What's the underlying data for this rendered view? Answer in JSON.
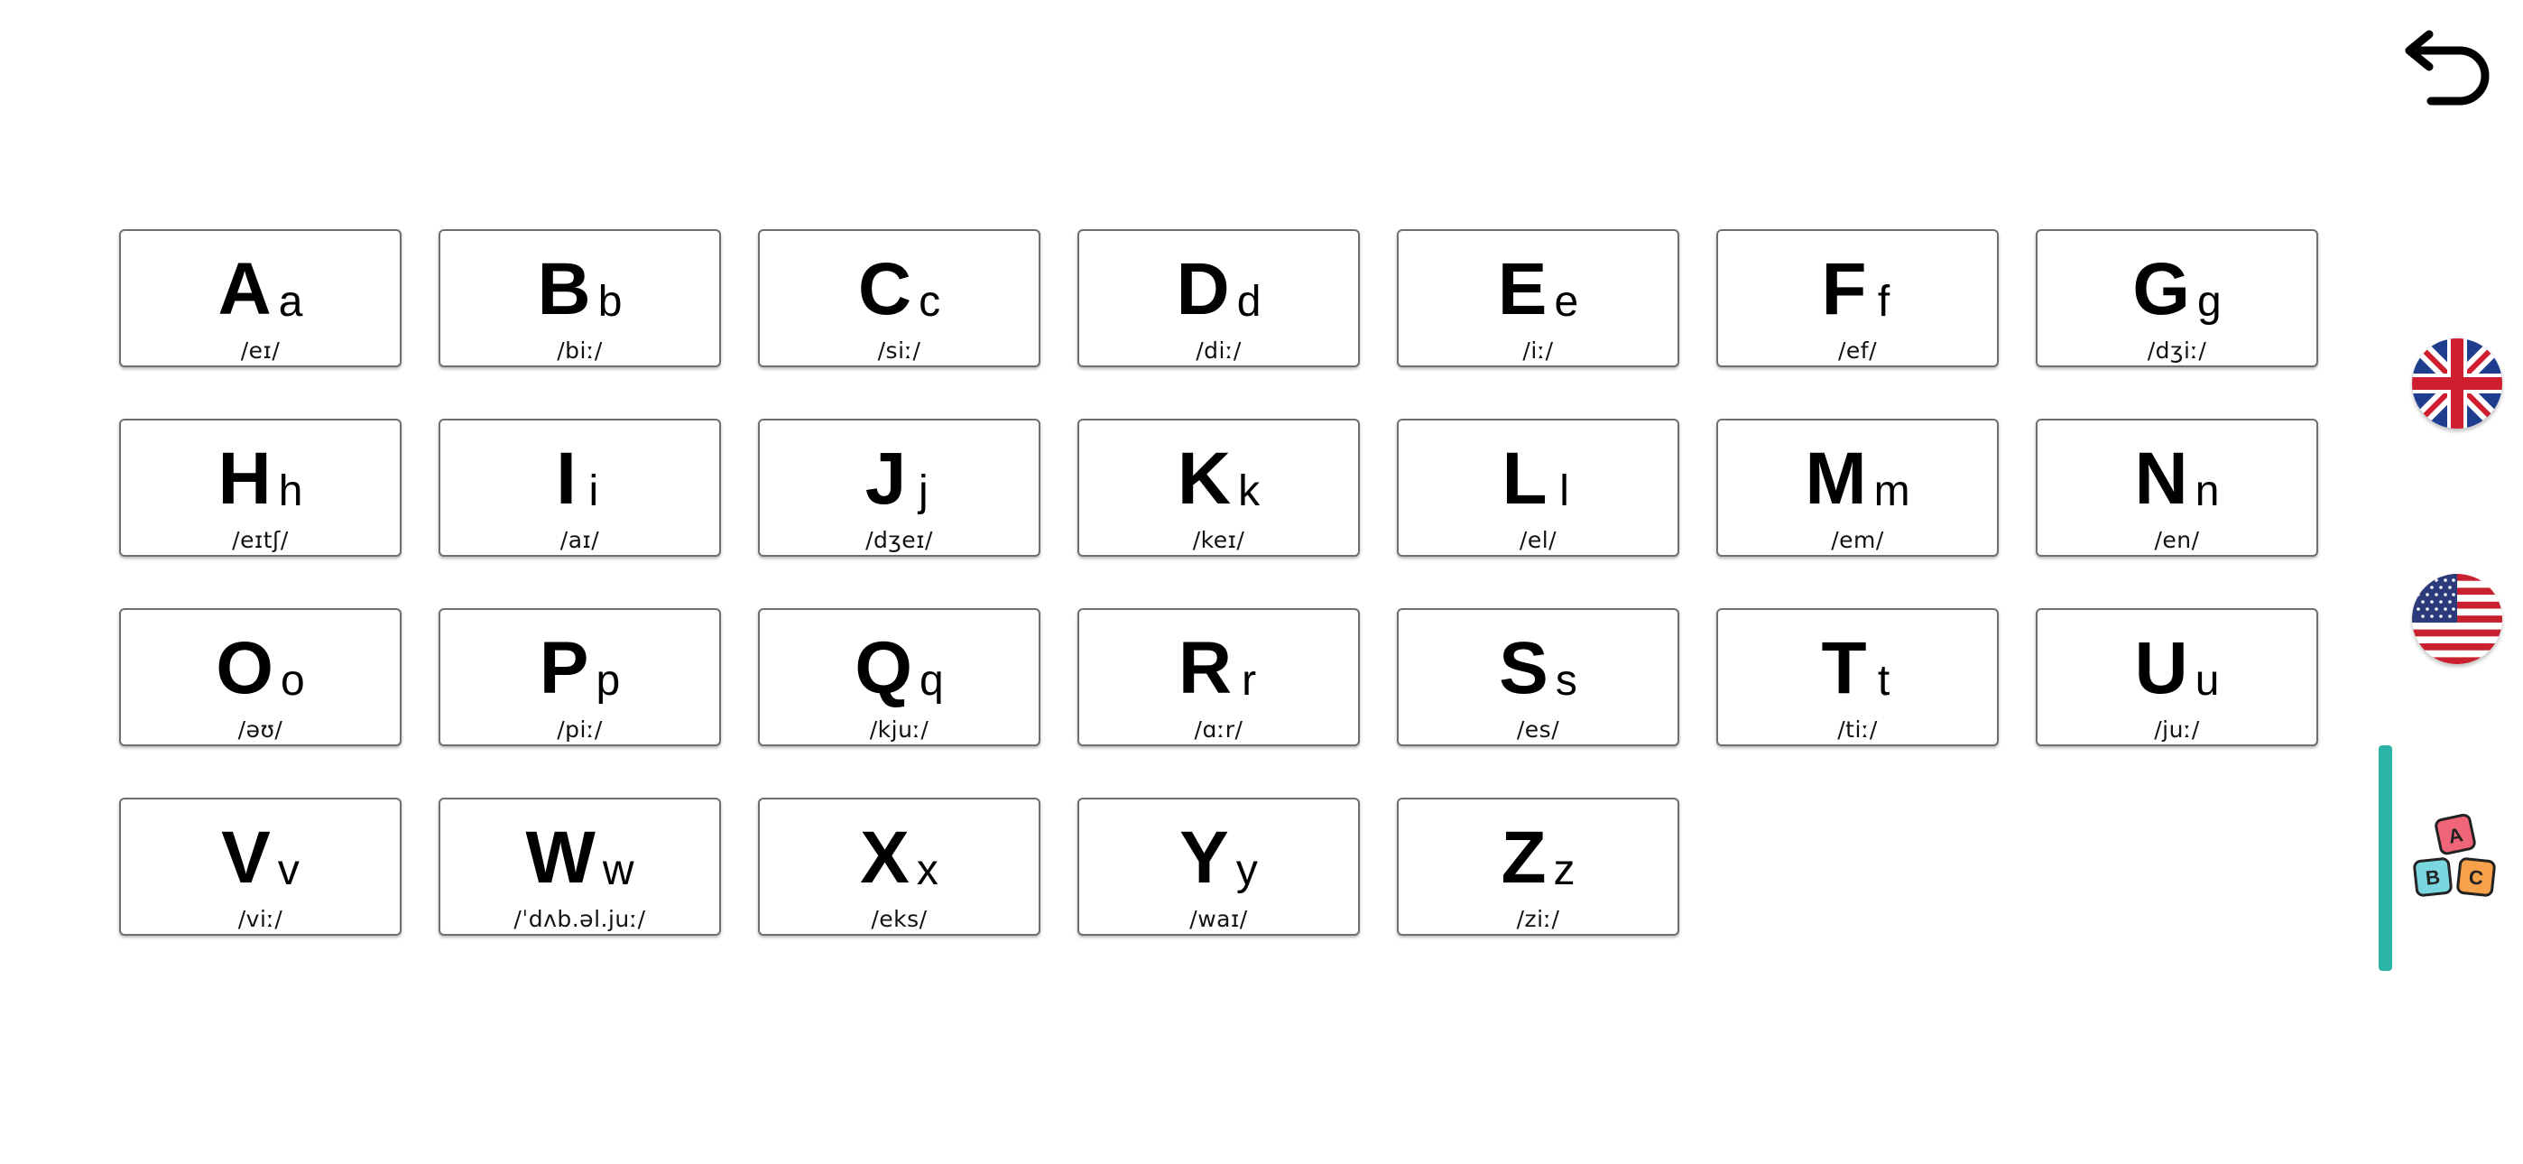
{
  "alphabet": [
    {
      "upper": "A",
      "lower": "a",
      "ipa": "/eɪ/"
    },
    {
      "upper": "B",
      "lower": "b",
      "ipa": "/biː/"
    },
    {
      "upper": "C",
      "lower": "c",
      "ipa": "/siː/"
    },
    {
      "upper": "D",
      "lower": "d",
      "ipa": "/diː/"
    },
    {
      "upper": "E",
      "lower": "e",
      "ipa": "/iː/"
    },
    {
      "upper": "F",
      "lower": "f",
      "ipa": "/ef/"
    },
    {
      "upper": "G",
      "lower": "g",
      "ipa": "/dʒiː/"
    },
    {
      "upper": "H",
      "lower": "h",
      "ipa": "/eɪtʃ/"
    },
    {
      "upper": "I",
      "lower": "i",
      "ipa": "/aɪ/"
    },
    {
      "upper": "J",
      "lower": "j",
      "ipa": "/dʒeɪ/"
    },
    {
      "upper": "K",
      "lower": "k",
      "ipa": "/keɪ/"
    },
    {
      "upper": "L",
      "lower": "l",
      "ipa": "/el/"
    },
    {
      "upper": "M",
      "lower": "m",
      "ipa": "/em/"
    },
    {
      "upper": "N",
      "lower": "n",
      "ipa": "/en/"
    },
    {
      "upper": "O",
      "lower": "o",
      "ipa": "/əʊ/"
    },
    {
      "upper": "P",
      "lower": "p",
      "ipa": "/piː/"
    },
    {
      "upper": "Q",
      "lower": "q",
      "ipa": "/kjuː/"
    },
    {
      "upper": "R",
      "lower": "r",
      "ipa": "/ɑːr/"
    },
    {
      "upper": "S",
      "lower": "s",
      "ipa": "/es/"
    },
    {
      "upper": "T",
      "lower": "t",
      "ipa": "/tiː/"
    },
    {
      "upper": "U",
      "lower": "u",
      "ipa": "/juː/"
    },
    {
      "upper": "V",
      "lower": "v",
      "ipa": "/viː/"
    },
    {
      "upper": "W",
      "lower": "w",
      "ipa": "/ˈdʌb.əl.juː/"
    },
    {
      "upper": "X",
      "lower": "x",
      "ipa": "/eks/"
    },
    {
      "upper": "Y",
      "lower": "y",
      "ipa": "/waɪ/"
    },
    {
      "upper": "Z",
      "lower": "z",
      "ipa": "/ziː/"
    }
  ],
  "sidebar": {
    "back_icon": "back-arrow-icon",
    "languages": [
      {
        "icon": "uk-flag-icon",
        "name": "UK"
      },
      {
        "icon": "us-flag-icon",
        "name": "US"
      }
    ],
    "abc_icon": "abc-blocks-icon",
    "abc_blocks": [
      "A",
      "B",
      "C"
    ],
    "accent_color": "#2bb3a7",
    "block_colors": [
      "#f0657a",
      "#7ad6e0",
      "#f7a14a"
    ]
  }
}
